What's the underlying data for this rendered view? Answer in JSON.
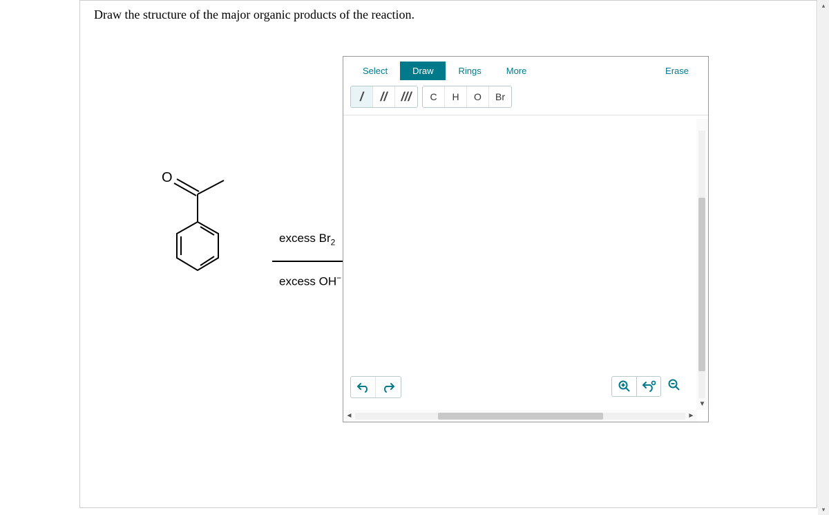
{
  "question": "Draw the structure of the major organic products of the reaction.",
  "toolbar": {
    "tabs": {
      "select": "Select",
      "draw": "Draw",
      "rings": "Rings",
      "more": "More",
      "erase": "Erase"
    },
    "elements": {
      "c": "C",
      "h": "H",
      "o": "O",
      "br": "Br"
    }
  },
  "reaction": {
    "reagent1_prefix": "excess Br",
    "reagent1_sub": "2",
    "reagent2_prefix": "excess OH",
    "reagent2_sup": "−"
  }
}
